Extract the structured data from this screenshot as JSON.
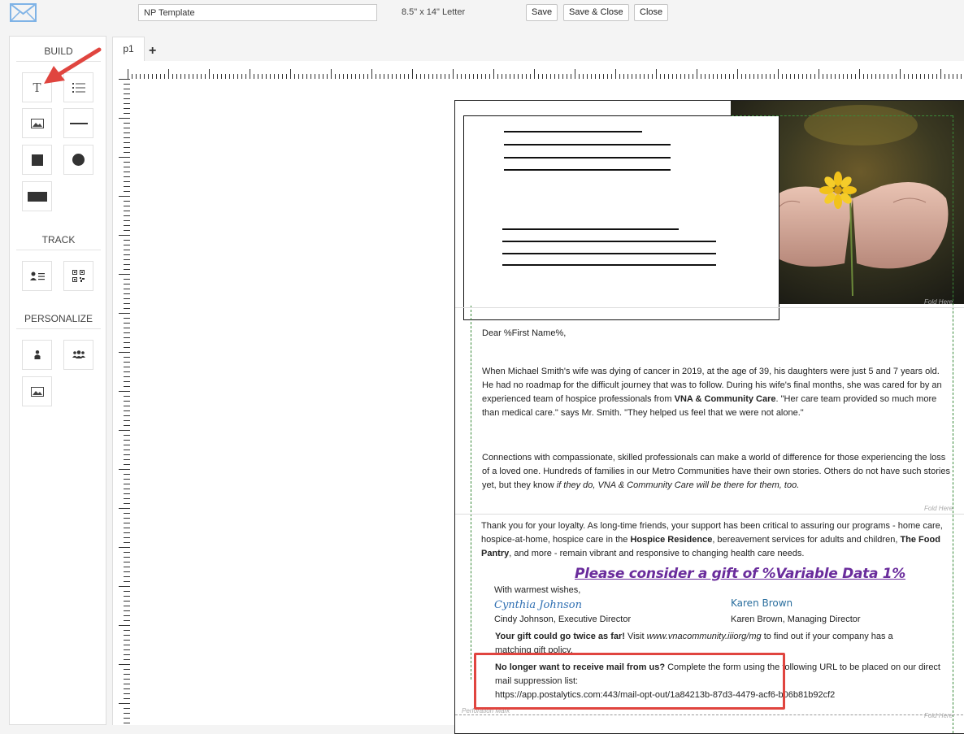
{
  "toolbar": {
    "template_name": "NP Template",
    "paper_size": "8.5\" x 14\" Letter",
    "save_label": "Save",
    "save_close_label": "Save & Close",
    "close_label": "Close"
  },
  "sidebar": {
    "build_heading": "BUILD",
    "track_heading": "TRACK",
    "personalize_heading": "PERSONALIZE"
  },
  "tabs": {
    "page_tab": "p1",
    "add_tab": "+"
  },
  "letter": {
    "greeting": "Dear %First Name%,",
    "p1_a": "When Michael Smith's wife was dying of cancer in 2019, at the age of 39, his daughters were just 5 and 7 years old. He had no roadmap for the difficult journey that was to follow. During his wife's final months, she was cared for by an experienced team of hospice professionals from ",
    "p1_b": "VNA & Community Care",
    "p1_c": ". \"Her care team provided so much more than medical care.\" says Mr. Smith. \"They helped us feel that we were not alone.\"",
    "p2_a": "Connections with compassionate, skilled professionals can make a world of difference for those experiencing the loss of a loved one. Hundreds of families in our Metro Communities have their own stories. Others do not have such stories yet, but they know ",
    "p2_b": "if they do, VNA & Community Care will be there for them, too.",
    "p3_a": "Thank you for your loyalty. As long-time friends, your support has been critical to assuring our programs - home care, hospice-at-home, hospice care in the ",
    "p3_b": "Hospice Residence",
    "p3_c": ", bereavement services for adults and children, ",
    "p3_d": "The Food Pantry",
    "p3_e": ", and more - remain vibrant and responsive to changing health care needs.",
    "cta": "Please consider a gift of %Variable Data 1%",
    "closing": "With warmest wishes,",
    "sig1_script": "Cynthia Johnson",
    "sig1_name": "Cindy Johnson, Executive Director",
    "sig2_script": "Karen Brown",
    "sig2_name": "Karen Brown, Managing Director",
    "match_a": "Your gift could go twice as far!",
    "match_b": " Visit ",
    "match_c": "www.vnacommunity.iiiorg/mg",
    "match_d": " to find out if your company has a matching gift policy.",
    "optout_a": "No longer want to receive mail from us?",
    "optout_b": " Complete the form using the following URL to be placed on our direct mail suppression list:",
    "optout_url": "https://app.postalytics.com:443/mail-opt-out/1a84213b-87d3-4479-acf6-b06b81b92cf2",
    "fold_label": "Fold Here",
    "perforation_label": "Perforation Mark"
  },
  "colors": {
    "accent_purple": "#6a2c9c",
    "annotation_red": "#e0453f",
    "guide_green": "#3a8a3a"
  }
}
